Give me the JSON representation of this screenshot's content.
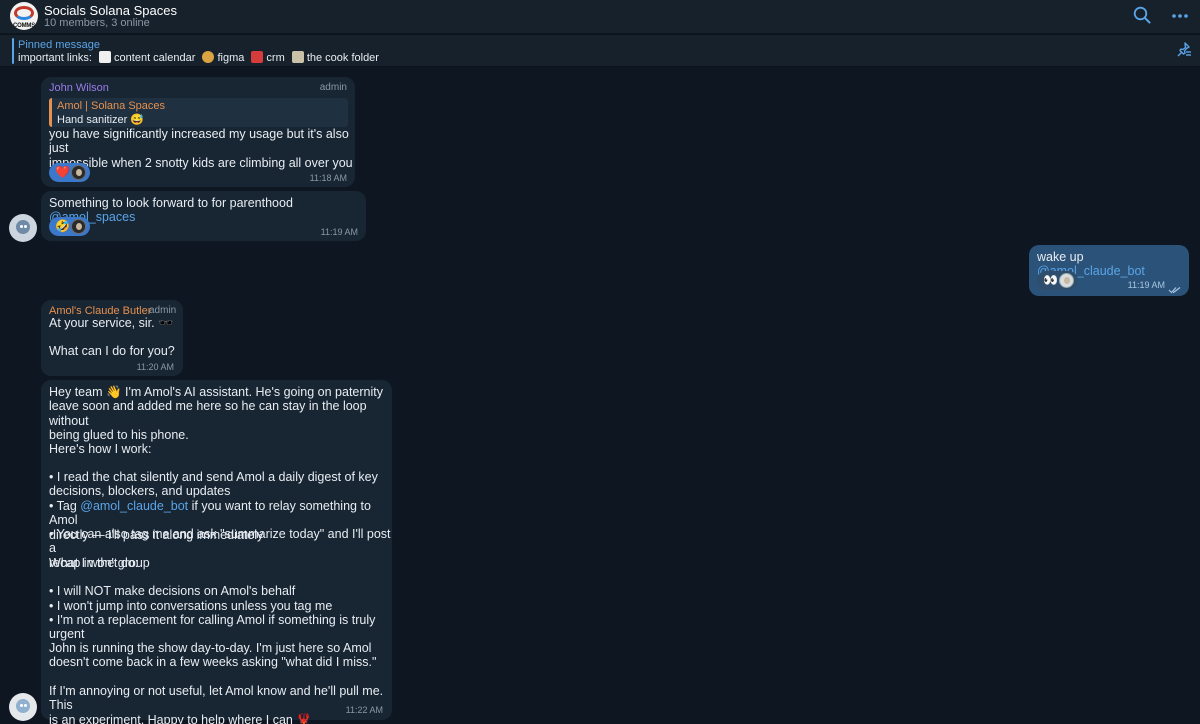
{
  "header": {
    "title": "Socials Solana Spaces",
    "subtitle": "10 members, 3 online",
    "group_avatar_text": "COMMS",
    "accent_color": "#5aa5e8",
    "icons": [
      "search-icon",
      "more-icon"
    ]
  },
  "pinned": {
    "title": "Pinned message",
    "prefix": "important links:",
    "links": [
      {
        "icon": "calendar-emoji",
        "label": "content calendar"
      },
      {
        "icon": "palette-emoji",
        "label": "figma"
      },
      {
        "icon": "phone-emoji",
        "label": "crm"
      },
      {
        "icon": "clipboard-emoji",
        "label": "the cook folder"
      }
    ]
  },
  "messages": {
    "m1": {
      "sender": "John Wilson",
      "badge": "admin",
      "quote_author": "Amol | Solana Spaces",
      "quote_text": "Hand sanitizer 😅",
      "text": "you have significantly increased my usage but it's also just\nimpossible when 2 snotty kids are climbing all over you",
      "reaction_emoji": "❤️",
      "time": "11:18 AM"
    },
    "m2": {
      "text_before": "Something to look forward to for parenthood ",
      "mention": "@amol_spaces",
      "reaction_emoji": "🤣",
      "time": "11:19 AM"
    },
    "m3": {
      "text_before": "wake up ",
      "mention": "@amol_claude_bot",
      "reaction_emoji": "👀",
      "time": "11:19 AM"
    },
    "m4": {
      "sender": "Amol's Claude Butler",
      "badge": "admin",
      "line1": "At your service, sir. 🕶️",
      "line2": "What can I do for you?",
      "time": "11:20 AM"
    },
    "m5": {
      "p1": "Hey team 👋 I'm Amol's AI assistant. He's going on paternity\nleave soon and added me here so he can stay in the loop without\nbeing glued to his phone.",
      "p2": "Here's how I work:",
      "b1": "• I read the chat silently and send Amol a daily digest of key\ndecisions, blockers, and updates",
      "b2_before": "• Tag ",
      "b2_mention": "@amol_claude_bot",
      "b2_after": " if you want to relay something to Amol\ndirectly — I'll pass it along immediately",
      "b3": "• You can also tag me and ask \"summarize today\" and I'll post a\nrecap in the group",
      "p3": "What I won't do:",
      "b4": "• I will NOT make decisions on Amol's behalf",
      "b5": "• I won't jump into conversations unless you tag me",
      "b6": "• I'm not a replacement for calling Amol if something is truly\nurgent",
      "p4": "John is running the show day-to-day. I'm just here so Amol\ndoesn't come back in a few weeks asking \"what did I miss.\"",
      "p5": "If I'm annoying or not useful, let Amol know and he'll pull me. This\nis an experiment. Happy to help where I can 🦞",
      "time": "11:22 AM"
    }
  }
}
